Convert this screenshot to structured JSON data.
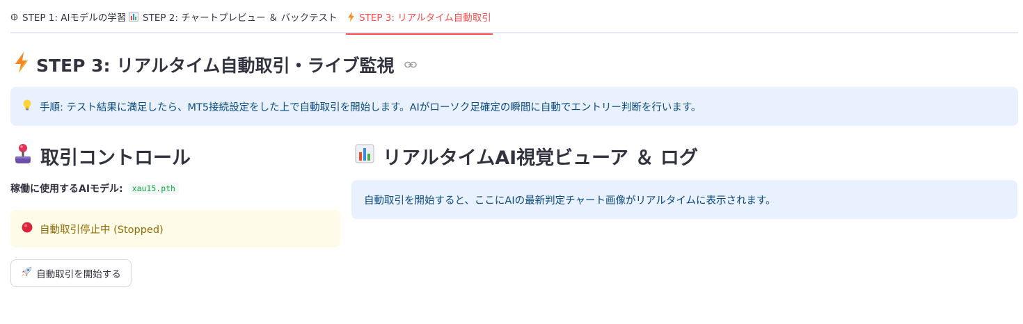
{
  "tabs": [
    {
      "label": "STEP 1: AIモデルの学習",
      "icon": "brain-icon"
    },
    {
      "label": "STEP 2: チャートプレビュー ＆ バックテスト",
      "icon": "bar-chart-icon"
    },
    {
      "label": "STEP 3: リアルタイム自動取引",
      "icon": "lightning-icon",
      "active": true
    }
  ],
  "page": {
    "title": "STEP 3: リアルタイム自動取引・ライブ監視",
    "title_icon": "lightning-icon",
    "anchor_icon": "link-icon"
  },
  "info": {
    "icon": "light-bulb-icon",
    "text": "手順: テスト結果に満足したら、MT5接続設定をした上で自動取引を開始します。AIがローソク足確定の瞬間に自動でエントリー判断を行います。"
  },
  "control": {
    "title": "取引コントロール",
    "icon": "joystick-icon",
    "model_label": "稼働に使用するAIモデル:",
    "model_value": "xau15.pth",
    "status_text": "自動取引停止中 (Stopped)",
    "status_icon": "red-circle-icon",
    "start_button": "自動取引を開始する",
    "start_icon": "rocket-icon"
  },
  "viewer": {
    "title": "リアルタイムAI視覚ビューア ＆ ログ",
    "icon": "bar-chart-icon",
    "info_text": "自動取引を開始すると、ここにAIの最新判定チャート画像がリアルタイムに表示されます。"
  },
  "colors": {
    "accent": "#ff4b4b",
    "info_bg": "#e8f1fd",
    "info_text": "#0b4a80",
    "warning_bg": "#fefce8",
    "warning_text": "#926c05",
    "code_text": "#09ab3b"
  }
}
